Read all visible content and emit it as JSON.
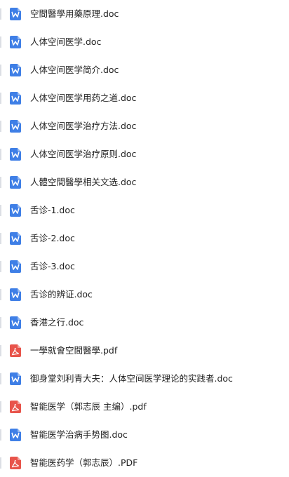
{
  "colors": {
    "doc_icon": "#3f7fe6",
    "pdf_icon": "#e8544b",
    "text": "#222222"
  },
  "files": [
    {
      "name": "空間醫學用藥原理.doc",
      "type": "doc",
      "icon": "word-doc-icon"
    },
    {
      "name": "人体空间医学.doc",
      "type": "doc",
      "icon": "word-doc-icon"
    },
    {
      "name": "人体空间医学简介.doc",
      "type": "doc",
      "icon": "word-doc-icon"
    },
    {
      "name": "人体空间医学用药之道.doc",
      "type": "doc",
      "icon": "word-doc-icon"
    },
    {
      "name": "人体空间医学治疗方法.doc",
      "type": "doc",
      "icon": "word-doc-icon"
    },
    {
      "name": "人体空间医学治疗原则.doc",
      "type": "doc",
      "icon": "word-doc-icon"
    },
    {
      "name": "人體空間醫學相关文选.doc",
      "type": "doc",
      "icon": "word-doc-icon"
    },
    {
      "name": "舌诊-1.doc",
      "type": "doc",
      "icon": "word-doc-icon"
    },
    {
      "name": "舌诊-2.doc",
      "type": "doc",
      "icon": "word-doc-icon"
    },
    {
      "name": "舌诊-3.doc",
      "type": "doc",
      "icon": "word-doc-icon"
    },
    {
      "name": "舌诊的辨证.doc",
      "type": "doc",
      "icon": "word-doc-icon"
    },
    {
      "name": "香港之行.doc",
      "type": "doc",
      "icon": "word-doc-icon"
    },
    {
      "name": "一學就會空間醫學.pdf",
      "type": "pdf",
      "icon": "pdf-icon"
    },
    {
      "name": "御身堂刘利青大夫：人体空间医学理论的实践者.doc",
      "type": "doc",
      "icon": "word-doc-icon"
    },
    {
      "name": "智能医学（郭志辰 主编）.pdf",
      "type": "pdf",
      "icon": "pdf-icon"
    },
    {
      "name": "智能医学治病手势图.doc",
      "type": "doc",
      "icon": "word-doc-icon"
    },
    {
      "name": "智能医药学（郭志辰）.PDF",
      "type": "pdf",
      "icon": "pdf-icon"
    }
  ]
}
